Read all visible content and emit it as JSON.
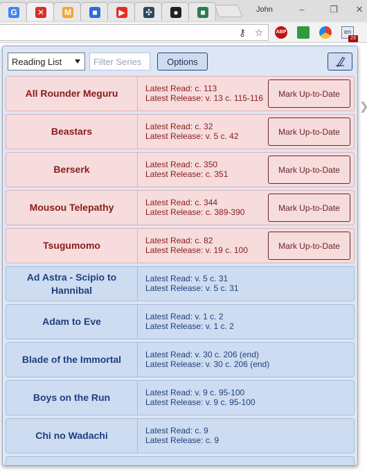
{
  "browser": {
    "user_name": "John",
    "tabs": [
      {
        "icon": "google-icon",
        "color": "#4285f4",
        "glyph": "G"
      },
      {
        "icon": "close-tab-icon",
        "color": "#d93025",
        "glyph": "✕"
      },
      {
        "icon": "manga-m-icon",
        "color": "#f4a536",
        "glyph": "M"
      },
      {
        "icon": "blue-app-icon",
        "color": "#2a6ed8",
        "glyph": "■"
      },
      {
        "icon": "youtube-icon",
        "color": "#e52d27",
        "glyph": "▶"
      },
      {
        "icon": "grid-icon",
        "color": "#2b4a5e",
        "glyph": "✣"
      },
      {
        "icon": "github-icon",
        "color": "#222222",
        "glyph": "●"
      },
      {
        "icon": "green-square-icon",
        "color": "#2e7d4f",
        "glyph": "■"
      }
    ],
    "extension_badge": "23",
    "extension_label": "en",
    "abp_label": "ABP"
  },
  "popup": {
    "list_select": "Reading List",
    "filter_placeholder": "Filter Series",
    "options_label": "Options",
    "mark_label": "Mark Up-to-Date",
    "colors": {
      "unread": "#f6dcdc",
      "read": "#cddcf1",
      "unread_text": "#8a1a1a",
      "read_text": "#1f3f7d"
    }
  },
  "series": [
    {
      "name": "All Rounder Meguru",
      "read": "Latest Read: c. 113",
      "release": "Latest Release: v. 13 c. 115-116",
      "up_to_date": false
    },
    {
      "name": "Beastars",
      "read": "Latest Read: c. 32",
      "release": "Latest Release: v. 5 c. 42",
      "up_to_date": false
    },
    {
      "name": "Berserk",
      "read": "Latest Read: c. 350",
      "release": "Latest Release: c. 351",
      "up_to_date": false
    },
    {
      "name": "Mousou Telepathy",
      "read": "Latest Read: c. 344",
      "release": "Latest Release: c. 389-390",
      "up_to_date": false
    },
    {
      "name": "Tsugumomo",
      "read": "Latest Read: c. 82",
      "release": "Latest Release: v. 19 c. 100",
      "up_to_date": false
    },
    {
      "name": "Ad Astra - Scipio to Hannibal",
      "read": "Latest Read: v. 5 c. 31",
      "release": "Latest Release: v. 5 c. 31",
      "up_to_date": true
    },
    {
      "name": "Adam to Eve",
      "read": "Latest Read: v. 1 c. 2",
      "release": "Latest Release: v. 1 c. 2",
      "up_to_date": true
    },
    {
      "name": "Blade of the Immortal",
      "read": "Latest Read: v. 30 c. 206 (end)",
      "release": "Latest Release: v. 30 c. 206 (end)",
      "up_to_date": true
    },
    {
      "name": "Boys on the Run",
      "read": "Latest Read: v. 9 c. 95-100",
      "release": "Latest Release: v. 9 c. 95-100",
      "up_to_date": true
    },
    {
      "name": "Chi no Wadachi",
      "read": "Latest Read: c. 9",
      "release": "Latest Release: c. 9",
      "up_to_date": true
    }
  ]
}
